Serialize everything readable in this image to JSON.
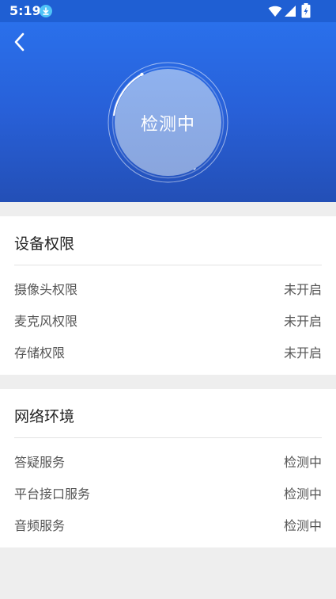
{
  "status_bar": {
    "time": "5:19",
    "icons": [
      "download-icon",
      "wifi-icon",
      "signal-icon",
      "battery-icon"
    ]
  },
  "header": {
    "back_icon": "chevron-left-icon",
    "status_text": "检测中",
    "colors": {
      "gradient_top": "#2a74f0",
      "gradient_bottom": "#234fb6",
      "circle": "#8fb2ef"
    }
  },
  "device_permissions": {
    "title": "设备权限",
    "items": [
      {
        "label": "摄像头权限",
        "value": "未开启"
      },
      {
        "label": "麦克风权限",
        "value": "未开启"
      },
      {
        "label": "存储权限",
        "value": "未开启"
      }
    ]
  },
  "network_environment": {
    "title": "网络环境",
    "items": [
      {
        "label": "答疑服务",
        "value": "检测中"
      },
      {
        "label": "平台接口服务",
        "value": "检测中"
      },
      {
        "label": "音频服务",
        "value": "检测中"
      }
    ]
  }
}
